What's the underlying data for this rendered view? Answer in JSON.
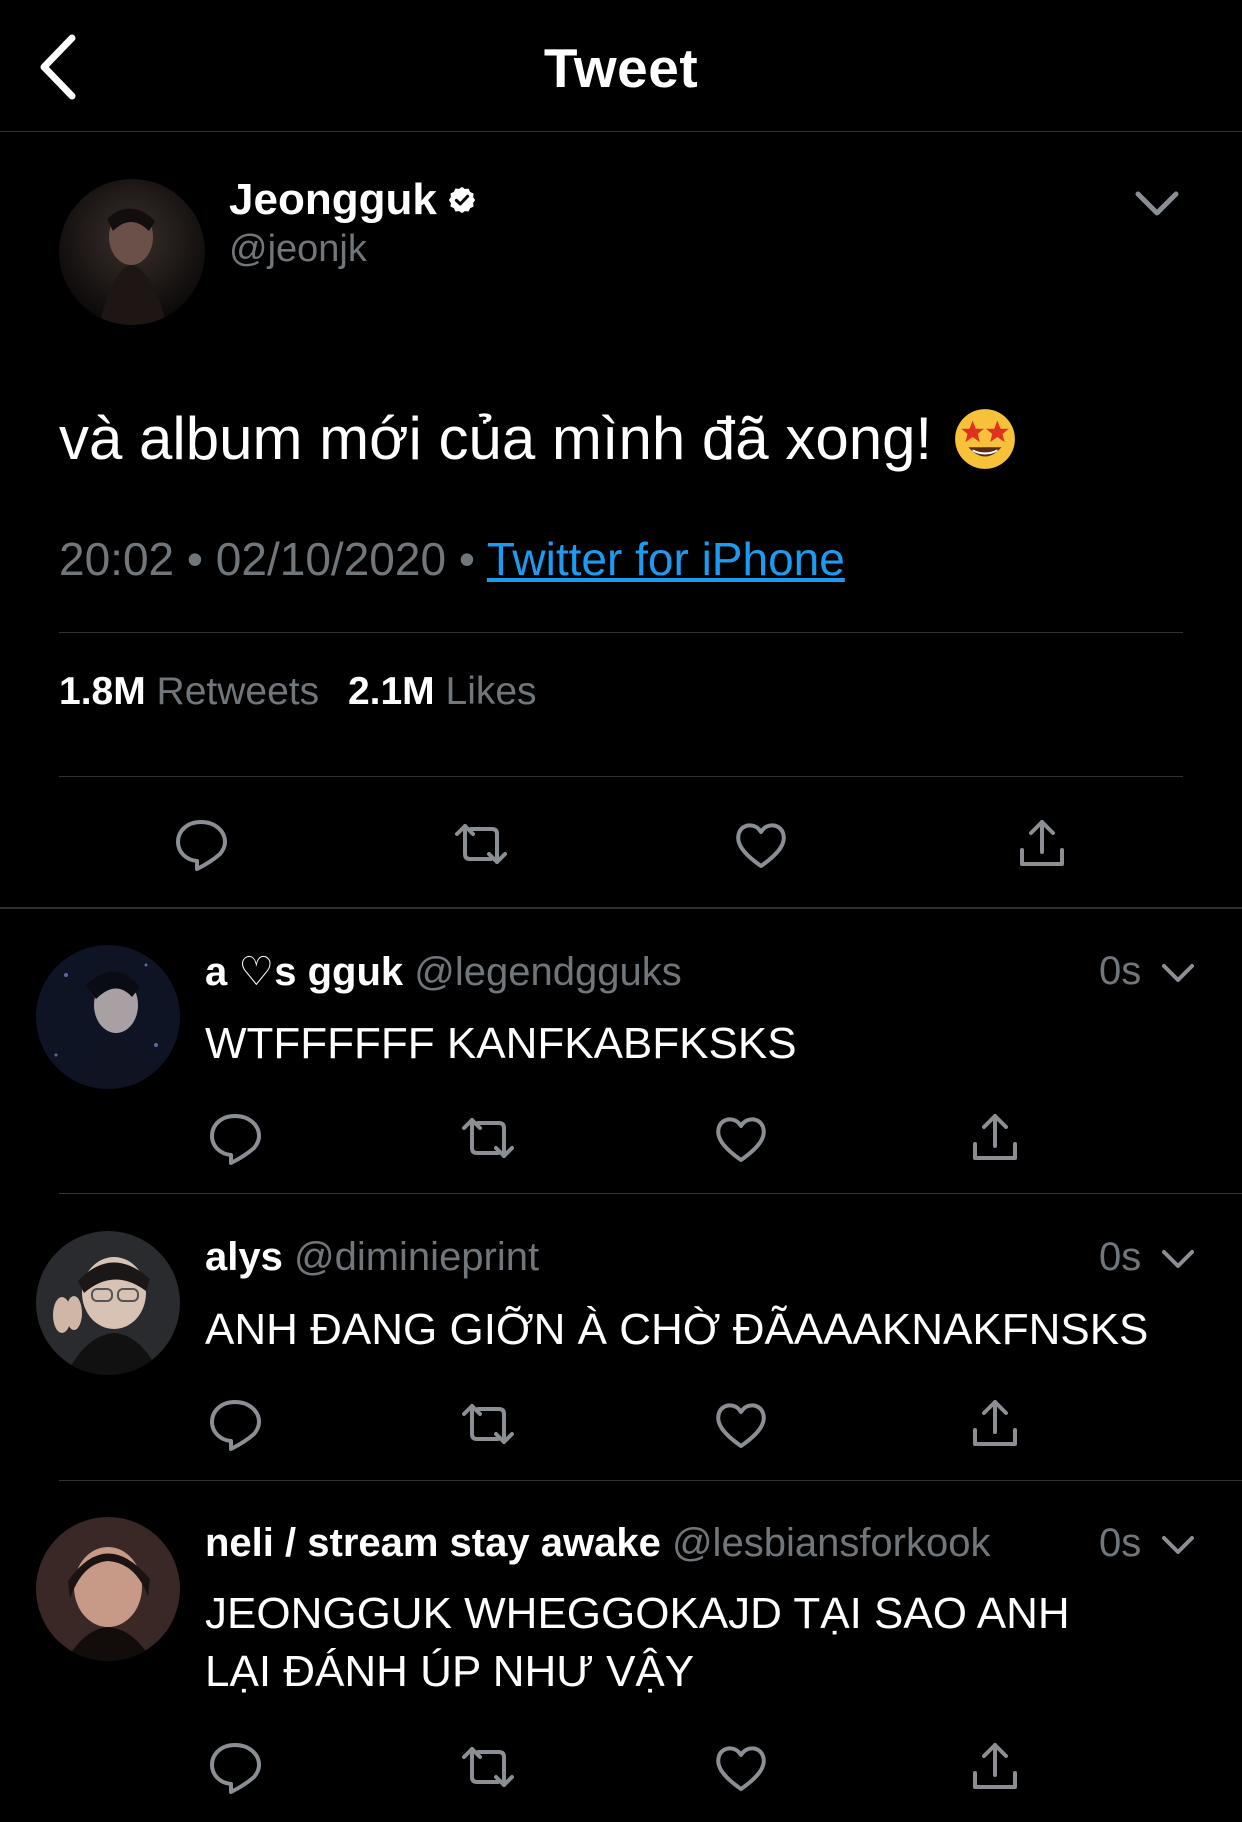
{
  "header": {
    "title": "Tweet"
  },
  "main_tweet": {
    "name": "Jeongguk",
    "handle": "@jeonjk",
    "text": "và album mới của mình đã xong!",
    "time": "20:02",
    "date": "02/10/2020",
    "source": "Twitter for iPhone",
    "retweets": "1.8M",
    "retweets_label": "Retweets",
    "likes": "2.1M",
    "likes_label": "Likes"
  },
  "replies": [
    {
      "name": "a ♡s gguk",
      "handle": "@legendgguks",
      "time": "0s",
      "text": "WTFFFFFF KANFKABFKSKS"
    },
    {
      "name": "alys",
      "handle": "@diminieprint",
      "time": "0s",
      "text": "ANH ĐANG GIỠN À CHỜ ĐÃAAAKNAKFNSKS"
    },
    {
      "name": "neli / stream stay awake",
      "handle": "@lesbiansforkook",
      "time": "0s",
      "text": "JEONGGUK WHEGGOKAJD TẠI SAO ANH LẠI ĐÁNH ÚP NHƯ VẬY"
    }
  ],
  "colors": {
    "background": "#000000",
    "muted": "#71767b",
    "link": "#1d9bf0",
    "verified": "#ffffff"
  }
}
